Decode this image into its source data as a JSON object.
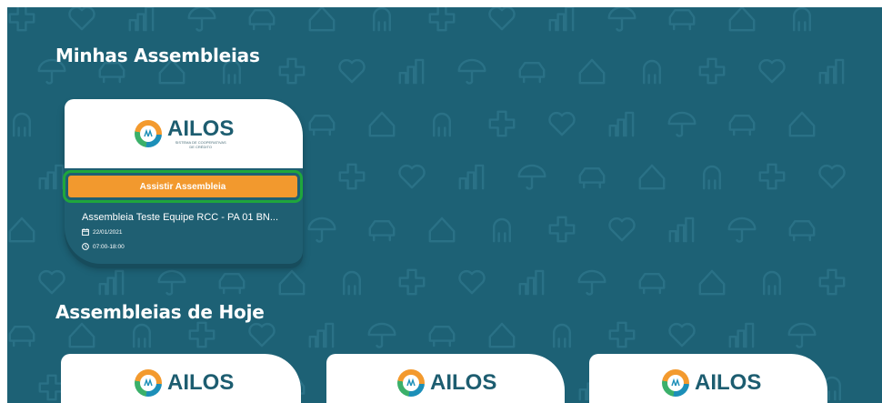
{
  "sections": {
    "mine_title": "Minhas Assembleias",
    "today_title": "Assembleias de Hoje"
  },
  "brand": {
    "logo_text": "AILOS",
    "logo_subtitle_line1": "SISTEMA DE COOPERATIVAS",
    "logo_subtitle_line2": "DE CRÉDITO"
  },
  "my_assembly": {
    "button_label": "Assistir Assembleia",
    "name": "Assembleia Teste Equipe RCC - PA 01 BN...",
    "date": "22/01/2021",
    "time": "07:00-18:00"
  },
  "today_cards": [
    {
      "logo_text": "AILOS"
    },
    {
      "logo_text": "AILOS"
    },
    {
      "logo_text": "AILOS"
    }
  ],
  "colors": {
    "background": "#1d6175",
    "button": "#f2992e",
    "highlight": "#1fa63c",
    "logo_text": "#1d5d70"
  },
  "icons": {
    "date": "calendar-icon",
    "time": "clock-icon",
    "background_pattern": [
      "house-icon",
      "tree-icon",
      "cross-icon",
      "heart-icon",
      "car-icon",
      "umbrella-icon",
      "chart-icon"
    ]
  }
}
